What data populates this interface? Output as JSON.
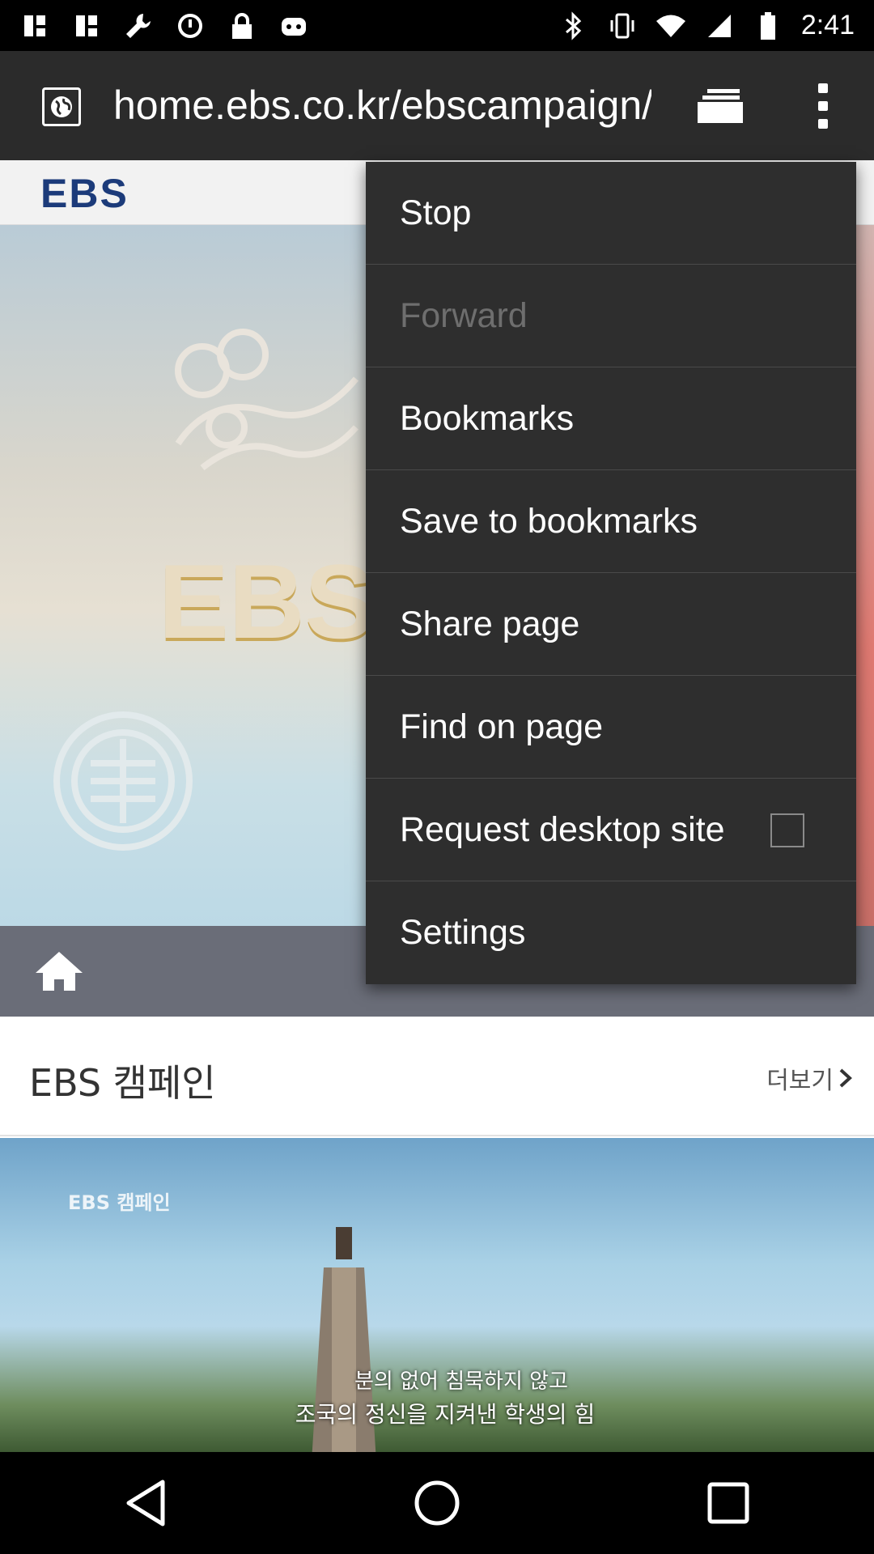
{
  "status_bar": {
    "time": "2:41",
    "left_icons": [
      "notification-icon",
      "notification-icon",
      "wrench-icon",
      "alarm-icon",
      "lock-icon",
      "android-icon"
    ],
    "right_icons": [
      "bluetooth-icon",
      "vibrate-icon",
      "wifi-icon",
      "signal-icon",
      "battery-icon"
    ]
  },
  "toolbar": {
    "url": "home.ebs.co.kr/ebscampaign/main"
  },
  "page": {
    "logo": "EBS",
    "hero_text": "EBS",
    "section_title": "EBS 캠페인",
    "more_link": "더보기",
    "photo_tag": "EBS 캠페인",
    "caption_line1": "분의 없어 침묵하지 않고",
    "caption_line2": "조국의 정신을 지켜낸 학생의 힘"
  },
  "menu": {
    "items": [
      {
        "label": "Stop",
        "enabled": true
      },
      {
        "label": "Forward",
        "enabled": false
      },
      {
        "label": "Bookmarks",
        "enabled": true
      },
      {
        "label": "Save to bookmarks",
        "enabled": true
      },
      {
        "label": "Share page",
        "enabled": true
      },
      {
        "label": "Find on page",
        "enabled": true
      },
      {
        "label": "Request desktop site",
        "enabled": true,
        "checked": false
      },
      {
        "label": "Settings",
        "enabled": true
      }
    ]
  },
  "colors": {
    "toolbar_bg": "#2b2b2b",
    "menu_bg": "#2e2e2e",
    "progress": "#4a90d9",
    "ebs_blue": "#1c3b7a"
  }
}
